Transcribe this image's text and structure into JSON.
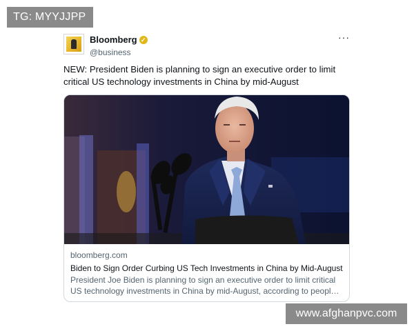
{
  "watermarks": {
    "top": "TG: MYYJJPP",
    "bottom": "www.afghanpvc.com"
  },
  "tweet": {
    "name": "Bloomberg",
    "verified_icon": "verified-badge-icon",
    "handle": "@business",
    "more_icon": "more-options-icon",
    "more_label": "···",
    "text": "NEW: President Biden is planning to sign an executive order to limit critical US technology investments in China by mid-August",
    "card": {
      "image_alt": "Photo of President Biden speaking at a podium with microphones",
      "domain": "bloomberg.com",
      "headline": "Biden to Sign Order Curbing US Tech Investments in China by Mid-August",
      "description": "President Joe Biden is planning to sign an executive order to limit critical US technology investments in China by mid-August, according to people familiar..."
    }
  },
  "colors": {
    "watermark_bg": "#8a8a8a",
    "badge_gold": "#e2b719",
    "secondary_text": "#536471",
    "card_border": "#cfd9de"
  }
}
